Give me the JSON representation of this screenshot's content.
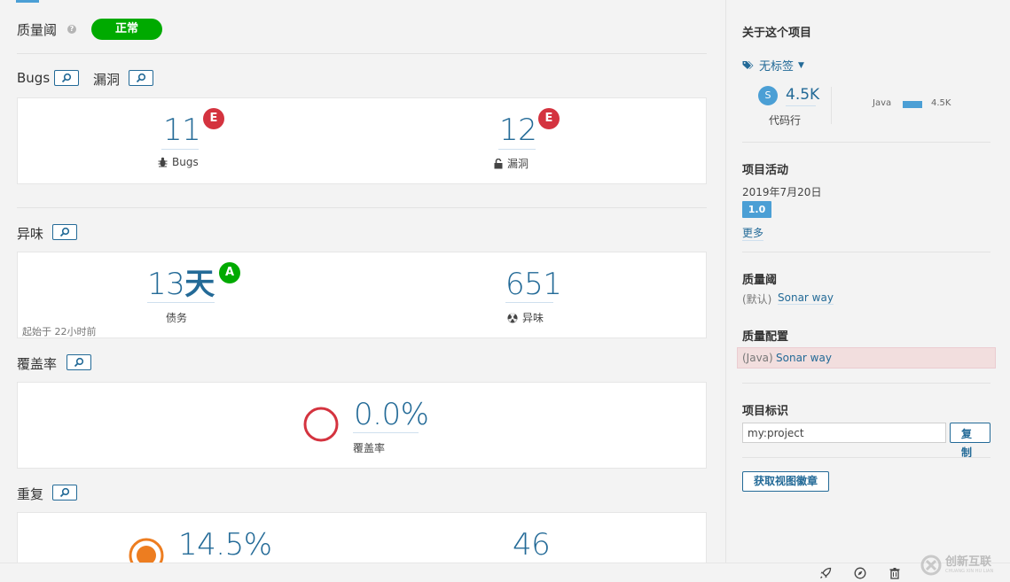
{
  "quality_gate": {
    "label": "质量阈",
    "status": "正常"
  },
  "bugs_section": {
    "title_bugs": "Bugs",
    "title_vulns": "漏洞",
    "bugs_value": "11",
    "bugs_rating": "E",
    "bugs_label": "Bugs",
    "vulns_value": "12",
    "vulns_rating": "E",
    "vulns_label": "漏洞"
  },
  "smells_section": {
    "title": "异味",
    "debt_value": "13",
    "debt_unit": "天",
    "debt_rating": "A",
    "debt_label": "债务",
    "smells_value": "651",
    "smells_label": "异味",
    "since_note": "起始于 22小时前"
  },
  "coverage_section": {
    "title": "覆盖率",
    "value": "0.0%",
    "label": "覆盖率"
  },
  "duplication_section": {
    "title": "重复",
    "value": "14.5%",
    "blocks_value": "46"
  },
  "sidebar": {
    "about_title": "关于这个项目",
    "tags_label": "无标签",
    "size_letter": "S",
    "lines_value": "4.5K",
    "lines_label": "代码行",
    "lang_name": "Java",
    "lang_value": "4.5K",
    "activity_title": "项目活动",
    "activity_date": "2019年7月20日",
    "activity_version": "1.0",
    "more_link": "更多",
    "gate_title": "质量阈",
    "gate_default": "(默认)",
    "gate_name": "Sonar way",
    "profile_title": "质量配置",
    "profile_lang": "(Java)",
    "profile_name": "Sonar way",
    "key_title": "项目标识",
    "key_value": "my:project",
    "copy_button": "复制",
    "badge_button": "获取视图徽章"
  },
  "watermark": {
    "text": "创新互联",
    "subtext": "CHUANG XIN HU LIAN"
  },
  "colors": {
    "accent": "#236a97",
    "ok": "#00aa00",
    "error": "#d4333f",
    "warning_orange": "#ed7d20",
    "profile_bg": "#f2dede"
  }
}
